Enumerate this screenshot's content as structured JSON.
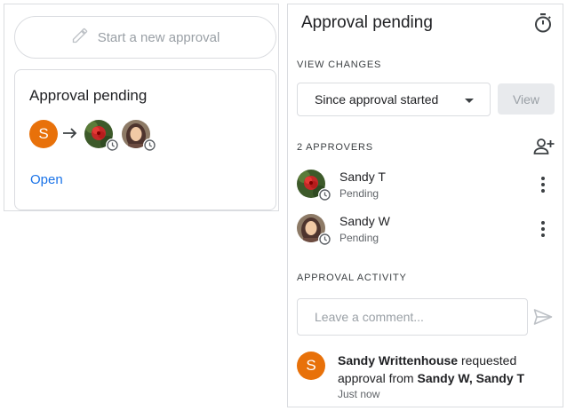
{
  "left": {
    "start_button_label": "Start a new approval",
    "card": {
      "title": "Approval pending",
      "requester_initial": "S",
      "open_link": "Open"
    }
  },
  "right": {
    "title": "Approval pending",
    "view_changes": {
      "label": "VIEW CHANGES",
      "selected_option": "Since approval started",
      "view_button": "View"
    },
    "approvers": {
      "label": "2 APPROVERS",
      "items": [
        {
          "name": "Sandy T",
          "status": "Pending"
        },
        {
          "name": "Sandy W",
          "status": "Pending"
        }
      ]
    },
    "activity": {
      "label": "APPROVAL ACTIVITY",
      "comment_placeholder": "Leave a comment...",
      "entries": [
        {
          "avatar_initial": "S",
          "actor": "Sandy Writtenhouse",
          "action": " requested approval from ",
          "targets": "Sandy W, Sandy T",
          "time": "Just now"
        }
      ]
    }
  },
  "colors": {
    "accent": "#1a73e8",
    "avatar_orange": "#e8710a",
    "border": "#dadce0",
    "disabled_button": "#e8eaed"
  },
  "icons": [
    "pencil-icon",
    "arrow-right-icon",
    "clock-icon",
    "timer-icon",
    "caret-down-icon",
    "add-person-icon",
    "more-vert-icon",
    "send-icon"
  ]
}
